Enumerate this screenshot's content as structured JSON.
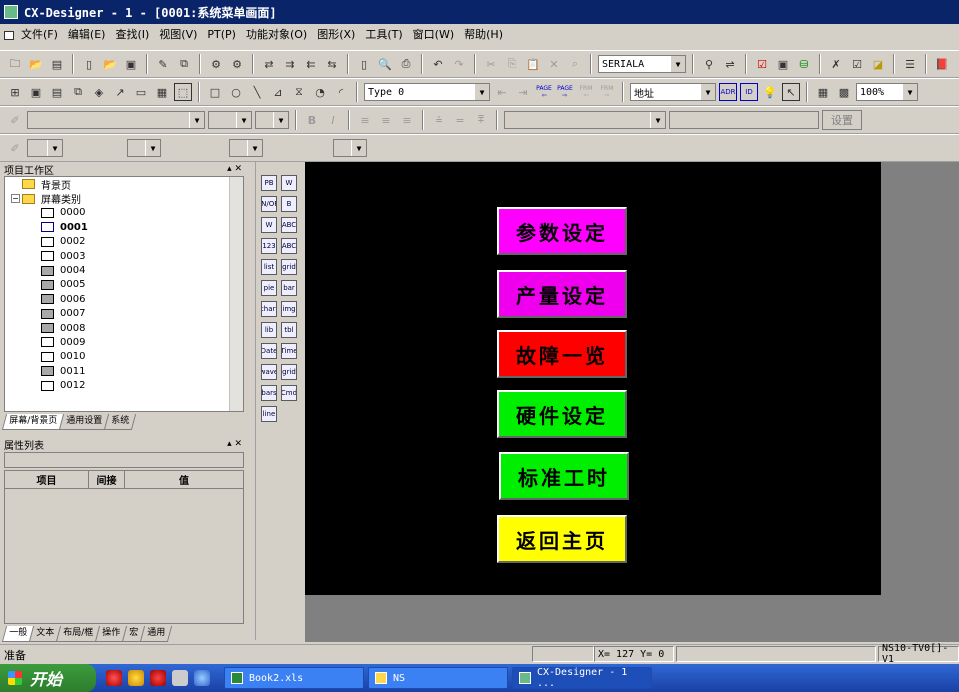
{
  "window": {
    "title": "CX-Designer - 1 - [0001:系统菜单画面]"
  },
  "menu": [
    "文件(F)",
    "编辑(E)",
    "查找(I)",
    "视图(V)",
    "PT(P)",
    "功能对象(O)",
    "图形(X)",
    "工具(T)",
    "窗口(W)",
    "帮助(H)"
  ],
  "toolbar1": {
    "serial_combo": "SERIALA"
  },
  "toolbar2": {
    "type_combo": "Type 0",
    "address_combo": "地址",
    "zoom_combo": "100%",
    "page_left": "PAGE",
    "page_right": "PAGE",
    "frm_left": "FRM",
    "frm_right": "FRM",
    "adr": "ADR",
    "id": "ID"
  },
  "toolbar3": {
    "setting_button": "设置"
  },
  "project_panel": {
    "title": "项目工作区",
    "tree": [
      {
        "label": "背景页",
        "type": "folder"
      },
      {
        "label": "屏幕类别",
        "type": "folder",
        "expanded": true
      },
      {
        "label": "0000",
        "color": "white"
      },
      {
        "label": "0001",
        "color": "white",
        "selected": true
      },
      {
        "label": "0002",
        "color": "white"
      },
      {
        "label": "0003",
        "color": "white"
      },
      {
        "label": "0004",
        "color": "grey"
      },
      {
        "label": "0005",
        "color": "grey"
      },
      {
        "label": "0006",
        "color": "grey"
      },
      {
        "label": "0007",
        "color": "grey"
      },
      {
        "label": "0008",
        "color": "grey"
      },
      {
        "label": "0009",
        "color": "white"
      },
      {
        "label": "0010",
        "color": "white"
      },
      {
        "label": "0011",
        "color": "grey"
      },
      {
        "label": "0012",
        "color": "white"
      }
    ],
    "tabs": [
      "屏幕/背景页",
      "通用设置",
      "系统"
    ]
  },
  "property_panel": {
    "title": "属性列表",
    "columns": [
      "项目",
      "间接",
      "值"
    ],
    "tabs": [
      "一般",
      "文本",
      "布局/框",
      "操作",
      "宏",
      "通用"
    ]
  },
  "palette": [
    [
      "PB",
      "W"
    ],
    [
      "ON/OFF",
      "B"
    ],
    [
      "W",
      "ABC"
    ],
    [
      "123",
      "ABC"
    ],
    [
      "list",
      "grid"
    ],
    [
      "pie",
      "bar"
    ],
    [
      "chart",
      "img"
    ],
    [
      "lib",
      "tbl"
    ],
    [
      "Date",
      "Time"
    ],
    [
      "wave",
      "grid"
    ],
    [
      "bars",
      "Cmd"
    ],
    [
      "line",
      ""
    ]
  ],
  "screen_buttons": [
    {
      "label": "参数设定",
      "color": "#ff00ff"
    },
    {
      "label": "产量设定",
      "color": "#ee00ee"
    },
    {
      "label": "故障一览",
      "color": "#ff0000"
    },
    {
      "label": "硬件设定",
      "color": "#00ee00"
    },
    {
      "label": "标准工时",
      "color": "#00ee00"
    },
    {
      "label": "返回主页",
      "color": "#ffff00"
    }
  ],
  "status": {
    "ready": "准备",
    "coords": "X= 127 Y=   0",
    "device": "NS10-TV0[]-V1"
  },
  "taskbar": {
    "start": "开始",
    "tasks": [
      "Book2.xls",
      "NS",
      "CX-Designer - 1 ..."
    ]
  },
  "colors": {
    "titlebar": "#0a246a",
    "canvas": "#000000",
    "workspace": "#808080",
    "taskbar": "#245edb"
  }
}
